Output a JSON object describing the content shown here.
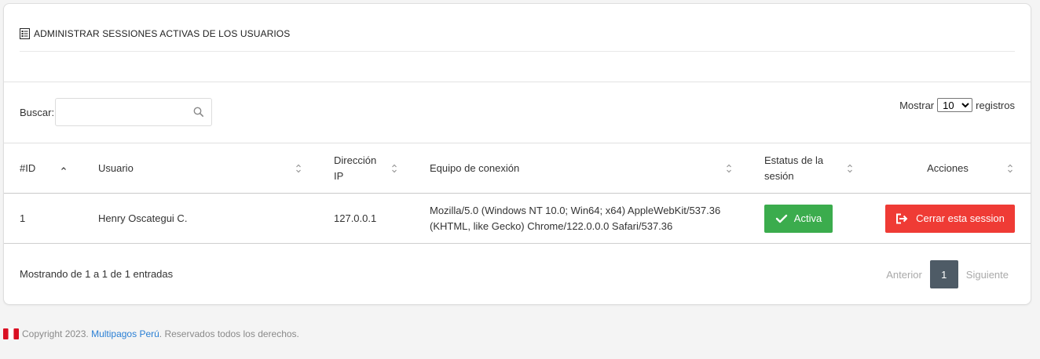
{
  "header": {
    "title": "ADMINISTRAR SESSIONES ACTIVAS DE LOS USUARIOS"
  },
  "search": {
    "label": "Buscar:",
    "value": "",
    "placeholder": ""
  },
  "length": {
    "label_before": "Mostrar",
    "selected": "10",
    "label_after": "registros"
  },
  "table": {
    "columns": [
      "#ID",
      "Usuario",
      "Dirección IP",
      "Equipo de conexión",
      "Estatus de la sesión",
      "Acciones"
    ],
    "rows": [
      {
        "id": "1",
        "usuario": "Henry Oscategui C.",
        "ip": "127.0.0.1",
        "equipo": "Mozilla/5.0 (Windows NT 10.0; Win64; x64) AppleWebKit/537.36 (KHTML, like Gecko) Chrome/122.0.0.0 Safari/537.36",
        "estatus": "Activa",
        "accion": "Cerrar esta session"
      }
    ]
  },
  "info": "Mostrando de 1 a 1 de 1 entradas",
  "pagination": {
    "prev": "Anterior",
    "current": "1",
    "next": "Siguiente"
  },
  "footer": {
    "prefix": "Copyright 2023.",
    "link": "Multipagos Perú",
    "suffix": ". Reservados todos los derechos."
  },
  "colors": {
    "activa": "#3bac4d",
    "cerrar": "#ef3b35",
    "page": "#4e5b66",
    "link": "#2a7fd4"
  }
}
